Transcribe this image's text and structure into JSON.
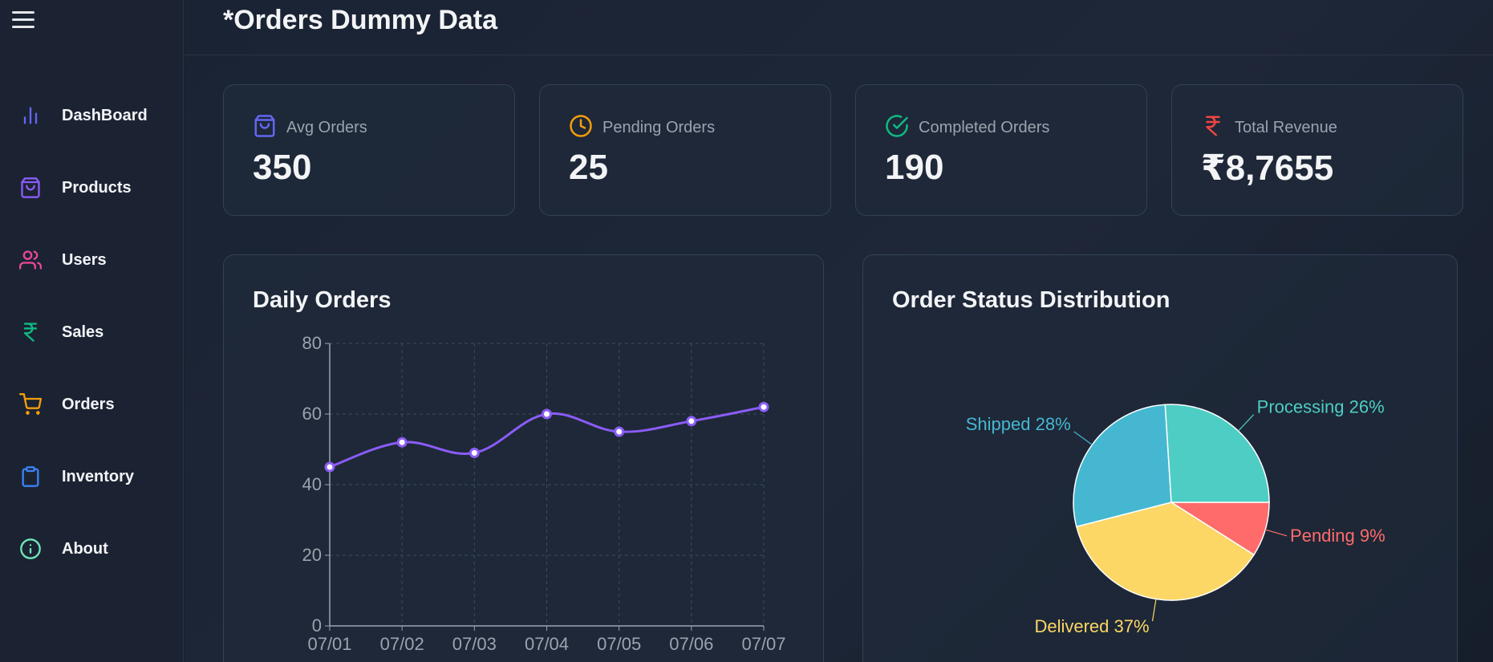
{
  "page": {
    "title": "*Orders Dummy Data"
  },
  "sidebar": {
    "menu_icon": "hamburger-icon",
    "items": [
      {
        "label": "DashBoard",
        "icon": "bar-chart-icon",
        "color": "#6366f1"
      },
      {
        "label": "Products",
        "icon": "shopping-bag-icon",
        "color": "#8b5cf6"
      },
      {
        "label": "Users",
        "icon": "users-icon",
        "color": "#ec4899"
      },
      {
        "label": "Sales",
        "icon": "rupee-icon",
        "color": "#10b981"
      },
      {
        "label": "Orders",
        "icon": "shopping-cart-icon",
        "color": "#f59e0b"
      },
      {
        "label": "Inventory",
        "icon": "clipboard-icon",
        "color": "#3b82f6"
      },
      {
        "label": "About",
        "icon": "info-icon",
        "color": "#6ee7b7"
      }
    ]
  },
  "stats": [
    {
      "label": "Avg Orders",
      "value": "350",
      "icon": "shopping-bag-icon",
      "color": "#6366f1"
    },
    {
      "label": "Pending Orders",
      "value": "25",
      "icon": "clock-icon",
      "color": "#f59e0b"
    },
    {
      "label": "Completed Orders",
      "value": "190",
      "icon": "check-circle-icon",
      "color": "#10b981"
    },
    {
      "label": "Total Revenue",
      "value": "₹8,7655",
      "icon": "rupee-icon",
      "color": "#ef4444"
    }
  ],
  "daily_orders": {
    "title": "Daily Orders"
  },
  "status_distribution": {
    "title": "Order Status Distribution"
  },
  "chart_data": [
    {
      "type": "line",
      "title": "Daily Orders",
      "x": [
        "07/01",
        "07/02",
        "07/03",
        "07/04",
        "07/05",
        "07/06",
        "07/07"
      ],
      "series": [
        {
          "values": [
            45,
            52,
            49,
            60,
            55,
            58,
            62
          ],
          "color": "#8b5cf6"
        }
      ],
      "ylim": [
        0,
        80
      ],
      "yticks": [
        0,
        20,
        40,
        60,
        80
      ],
      "grid": true
    },
    {
      "type": "pie",
      "title": "Order Status Distribution",
      "slices": [
        {
          "name": "Pending",
          "value": 9,
          "label": "Pending 9%",
          "color": "#ff6b6b"
        },
        {
          "name": "Delivered",
          "value": 37,
          "label": "Delivered 37%",
          "color": "#fcd766"
        },
        {
          "name": "Shipped",
          "value": 28,
          "label": "Shipped 28%",
          "color": "#45b7d1"
        },
        {
          "name": "Processing",
          "value": 26,
          "label": "Processing 26%",
          "color": "#4ecdc4"
        }
      ]
    }
  ]
}
